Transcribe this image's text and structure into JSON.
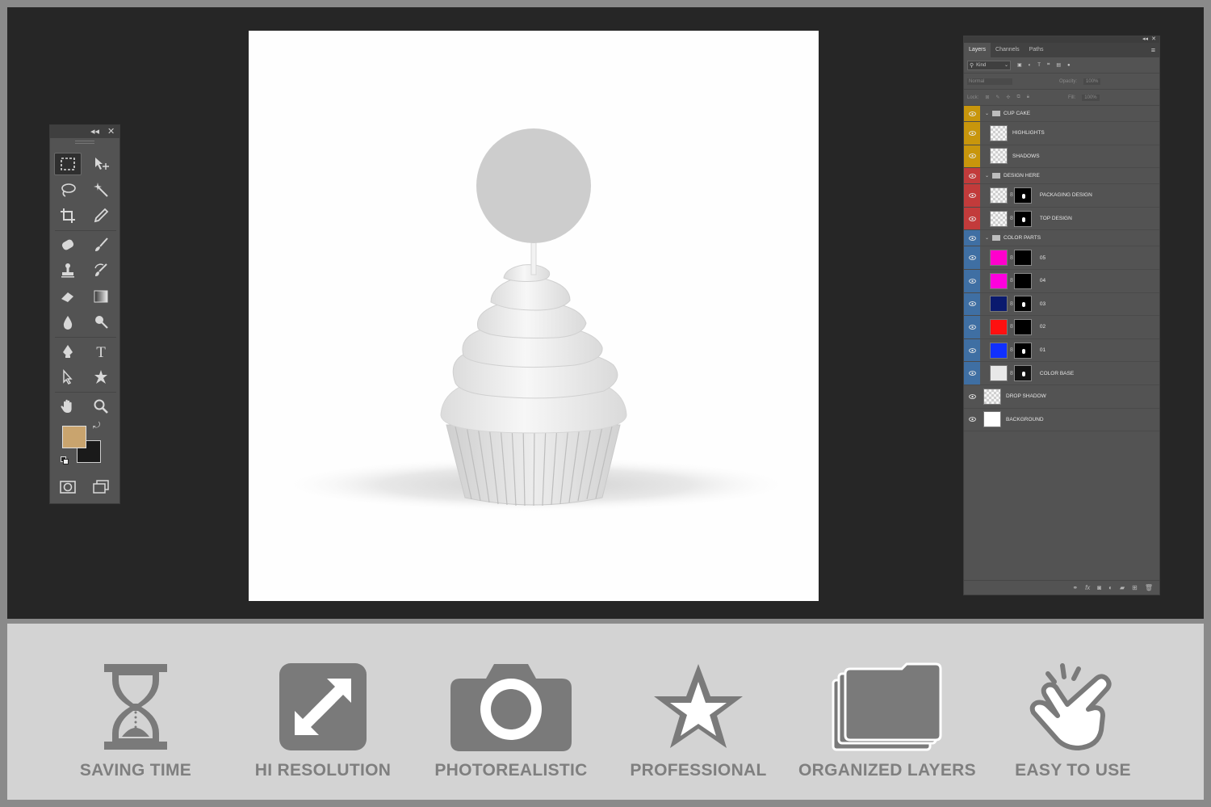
{
  "layers_panel": {
    "tabs": [
      "Layers",
      "Channels",
      "Paths"
    ],
    "filter_kind": "Kind",
    "blend_mode": "Normal",
    "opacity_label": "Opacity:",
    "opacity_value": "100%",
    "lock_label": "Lock:",
    "fill_label": "Fill:",
    "fill_value": "100%",
    "layers": [
      {
        "name": "CUP CAKE",
        "type": "group",
        "tag": "#c8960c"
      },
      {
        "name": "HIGHLIGHTS",
        "type": "layer",
        "tag": "#c8960c",
        "thumb": "check"
      },
      {
        "name": "SHADOWS",
        "type": "layer",
        "tag": "#c8960c",
        "thumb": "check"
      },
      {
        "name": "DESIGN HERE",
        "type": "group",
        "tag": "#c23b3b"
      },
      {
        "name": "PACKAGING DESIGN",
        "type": "smart",
        "tag": "#c23b3b",
        "thumb": "check"
      },
      {
        "name": "TOP DESIGN",
        "type": "smart",
        "tag": "#c23b3b",
        "thumb": "check"
      },
      {
        "name": "COLOR PARTS",
        "type": "group",
        "tag": "#3f6fa3"
      },
      {
        "name": "05",
        "type": "fill",
        "tag": "#3f6fa3",
        "color": "#ff00cc"
      },
      {
        "name": "04",
        "type": "fill",
        "tag": "#3f6fa3",
        "color": "#ff00dd"
      },
      {
        "name": "03",
        "type": "fill",
        "tag": "#3f6fa3",
        "color": "#0a1a6e"
      },
      {
        "name": "02",
        "type": "fill",
        "tag": "#3f6fa3",
        "color": "#ff1010"
      },
      {
        "name": "01",
        "type": "fill",
        "tag": "#3f6fa3",
        "color": "#1030ff"
      },
      {
        "name": "COLOR BASE",
        "type": "fill",
        "tag": "#3f6fa3",
        "color": "#e8e8e8"
      },
      {
        "name": "DROP SHADOW",
        "type": "layer",
        "tag": "",
        "thumb": "check"
      },
      {
        "name": "BACKGROUND",
        "type": "layer",
        "tag": "",
        "thumb": "white"
      }
    ]
  },
  "toolbox": {
    "foreground_color": "#c9a46e",
    "background_color": "#1a1a1a",
    "icons": [
      "marquee-icon",
      "move-icon",
      "lasso-icon",
      "magic-wand-icon",
      "crop-icon",
      "eyedropper-icon",
      "healing-icon",
      "brush-icon",
      "stamp-icon",
      "history-brush-icon",
      "eraser-icon",
      "gradient-icon",
      "blur-icon",
      "dodge-icon",
      "pen-icon",
      "type-icon",
      "path-select-icon",
      "shape-icon",
      "hand-icon",
      "zoom-icon"
    ]
  },
  "features": [
    {
      "label": "SAVING TIME",
      "icon": "hourglass-icon"
    },
    {
      "label": "HI RESOLUTION",
      "icon": "expand-icon"
    },
    {
      "label": "PHOTOREALISTIC",
      "icon": "camera-icon"
    },
    {
      "label": "PROFESSIONAL",
      "icon": "star-icon"
    },
    {
      "label": "ORGANIZED LAYERS",
      "icon": "folders-icon"
    },
    {
      "label": "EASY TO USE",
      "icon": "tap-hand-icon"
    }
  ]
}
